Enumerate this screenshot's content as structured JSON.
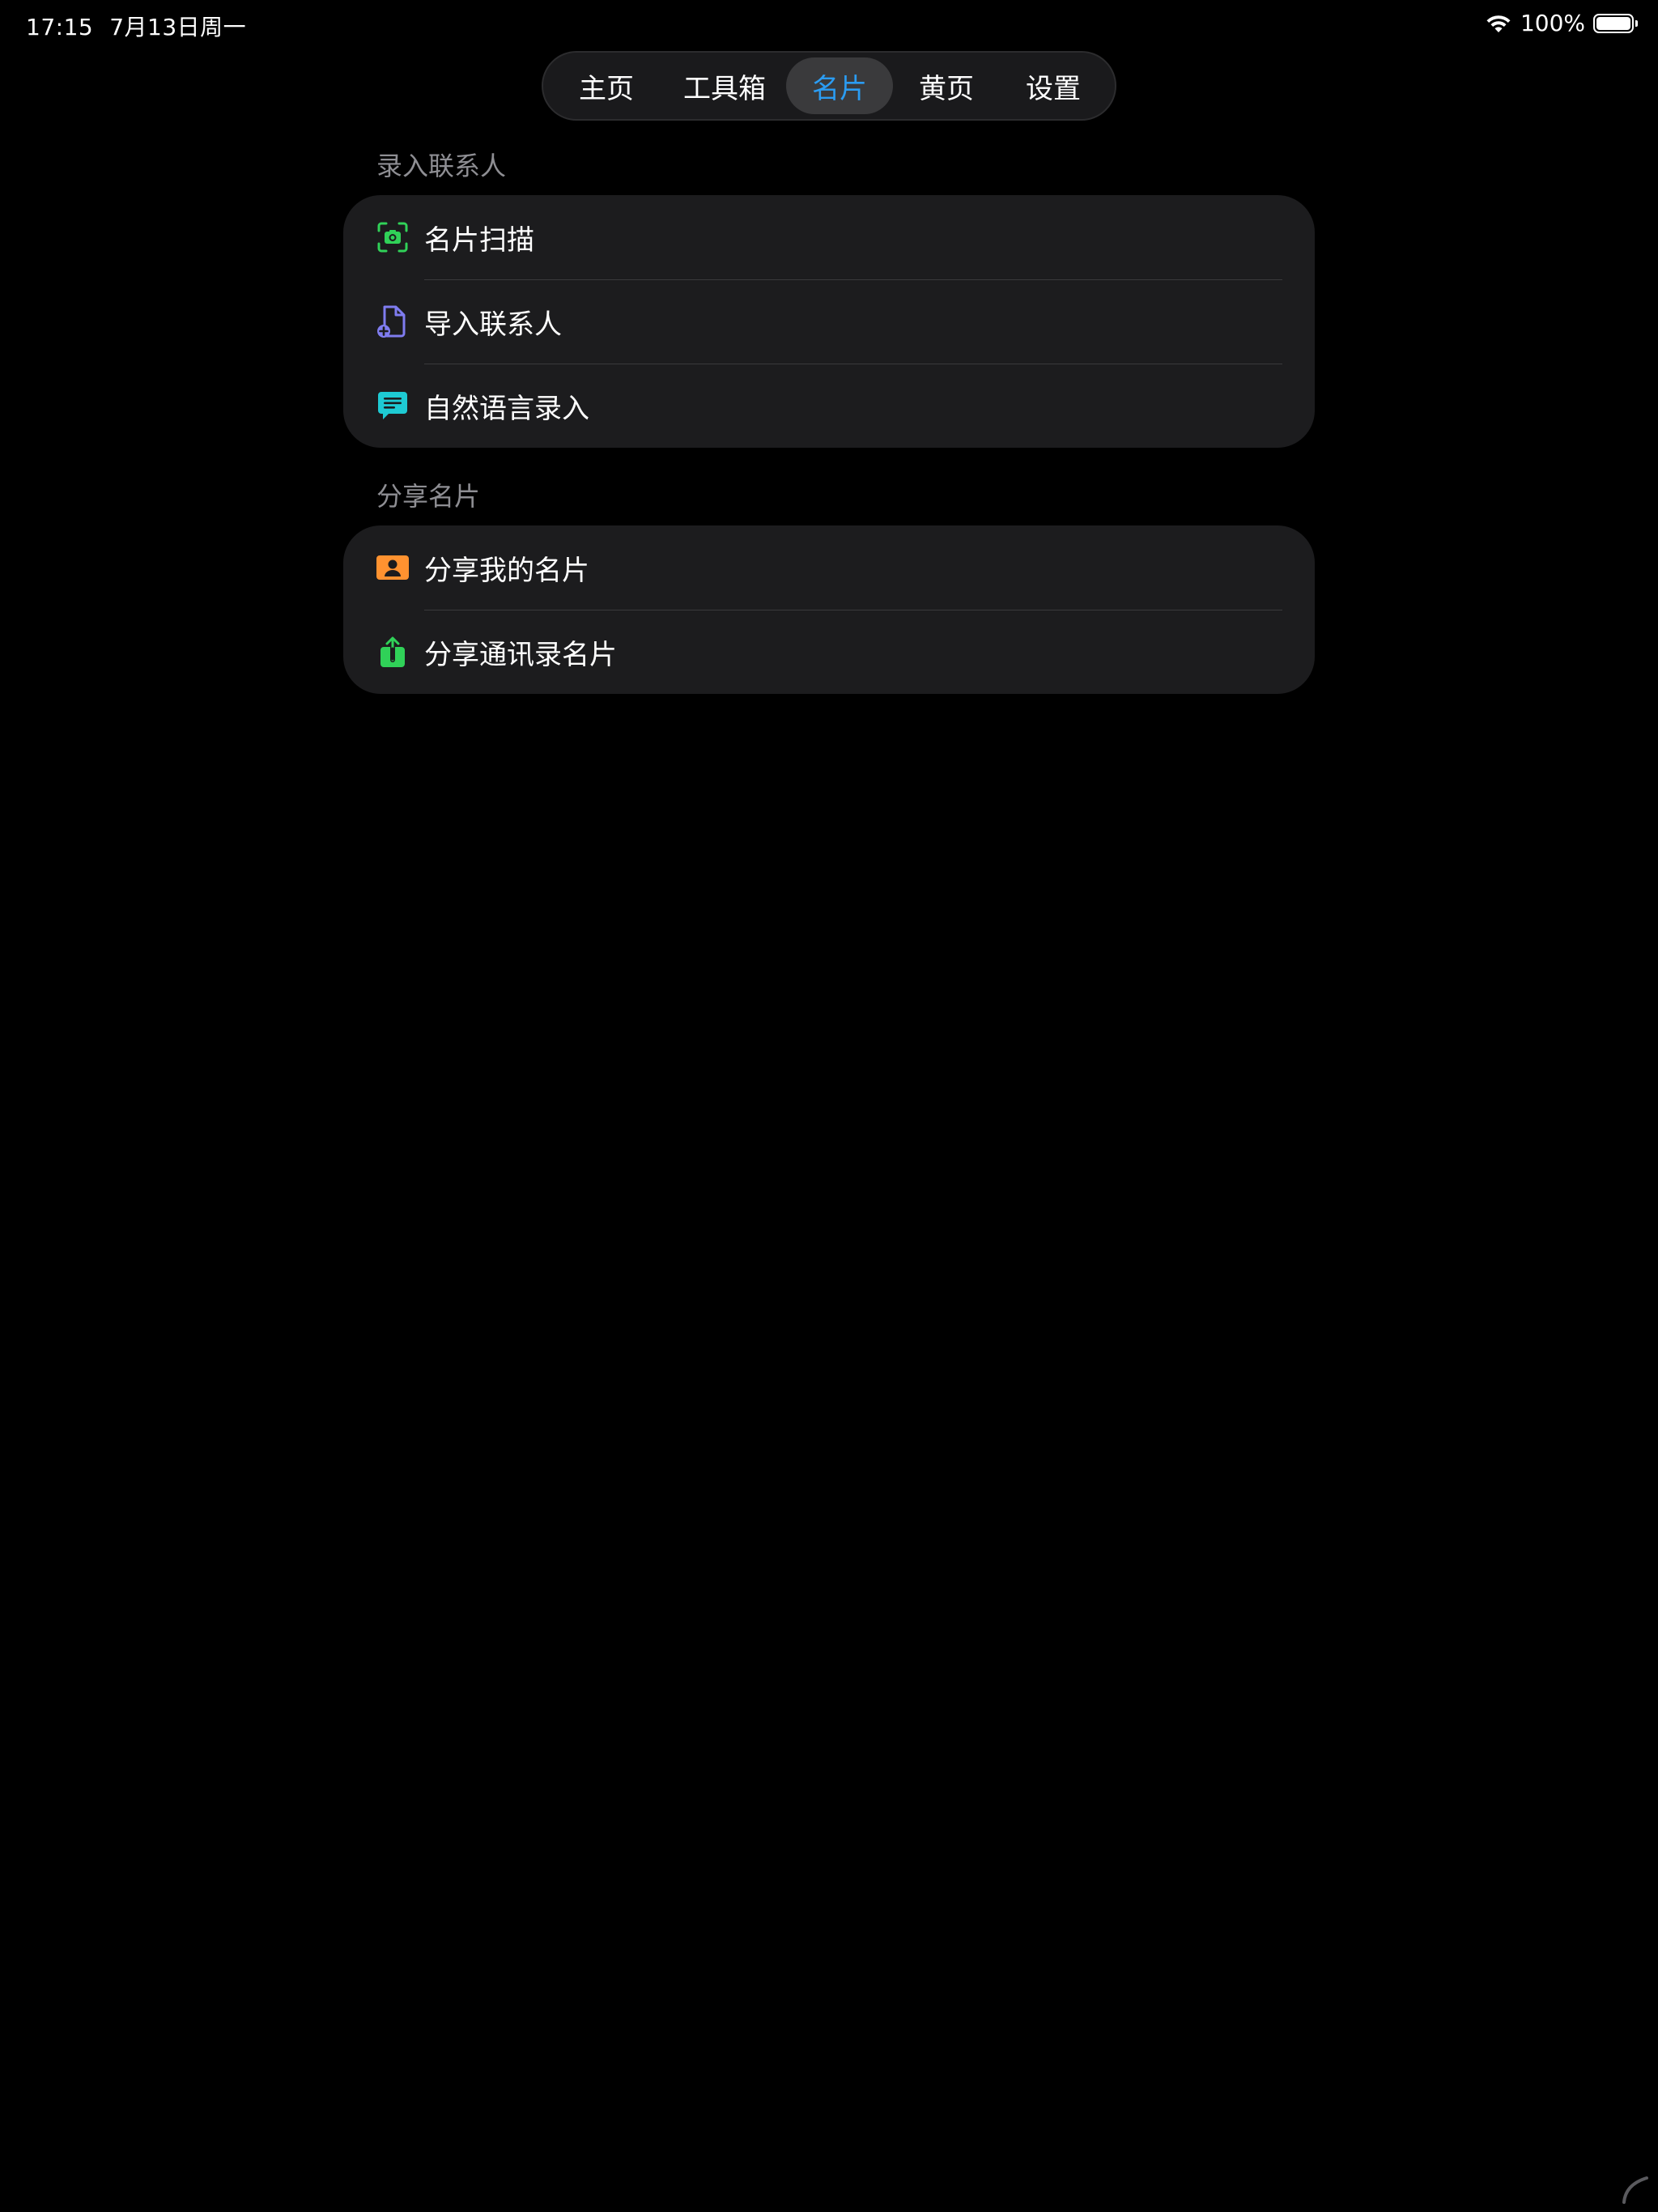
{
  "status_bar": {
    "time": "17:15",
    "date": "7月13日周一",
    "battery_percent": "100%",
    "battery_level": 1.0
  },
  "tabs": [
    {
      "label": "主页",
      "active": false
    },
    {
      "label": "工具箱",
      "active": false
    },
    {
      "label": "名片",
      "active": true
    },
    {
      "label": "黄页",
      "active": false
    },
    {
      "label": "设置",
      "active": false
    }
  ],
  "sections": [
    {
      "header": "录入联系人",
      "items": [
        {
          "label": "名片扫描",
          "icon": "camera-scan-icon",
          "color": "#30d158"
        },
        {
          "label": "导入联系人",
          "icon": "document-add-icon",
          "color": "#7f7cf0"
        },
        {
          "label": "自然语言录入",
          "icon": "chat-bubble-icon",
          "color": "#1ecad3"
        }
      ]
    },
    {
      "header": "分享名片",
      "items": [
        {
          "label": "分享我的名片",
          "icon": "contact-card-icon",
          "color": "#ff9230"
        },
        {
          "label": "分享通讯录名片",
          "icon": "share-icon",
          "color": "#30d158"
        }
      ]
    }
  ],
  "colors": {
    "background": "#000000",
    "group_background": "#1c1c1e",
    "accent": "#2b9cf2",
    "section_header": "#8e8e93"
  }
}
